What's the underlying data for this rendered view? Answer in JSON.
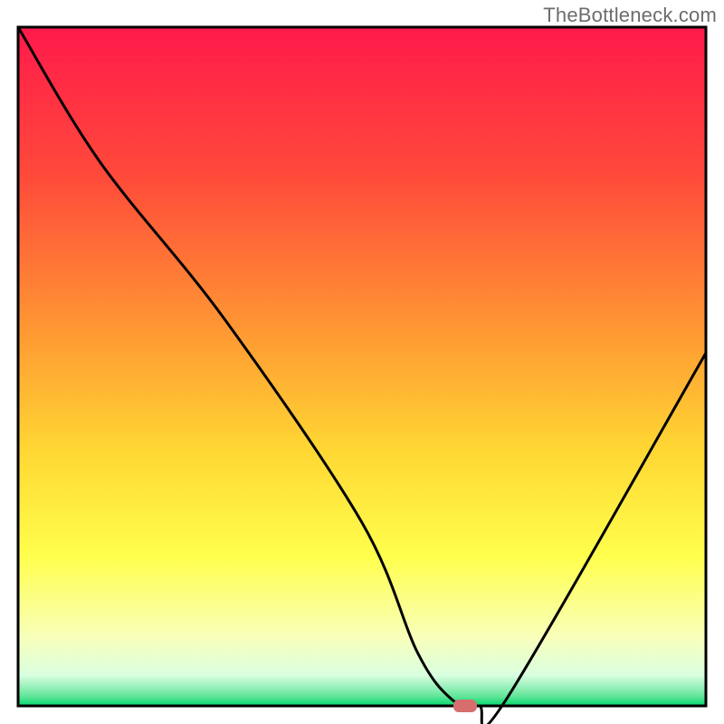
{
  "watermark": "TheBottleneck.com",
  "chart_data": {
    "type": "line",
    "title": "",
    "xlabel": "",
    "ylabel": "",
    "xlim": [
      0,
      100
    ],
    "ylim": [
      0,
      100
    ],
    "grid": false,
    "legend": false,
    "series": [
      {
        "name": "bottleneck-curve",
        "x": [
          0,
          12,
          30,
          50,
          58,
          63,
          67,
          71,
          100
        ],
        "y": [
          100,
          80,
          57,
          27,
          8,
          1,
          0,
          1,
          52
        ]
      }
    ],
    "marker": {
      "name": "sweet-spot",
      "x": 65,
      "y": 0,
      "color": "#d66e6e"
    },
    "gradient_stops": [
      {
        "offset": 0.0,
        "color": "#ff1a4b"
      },
      {
        "offset": 0.22,
        "color": "#ff4a3a"
      },
      {
        "offset": 0.45,
        "color": "#ff9933"
      },
      {
        "offset": 0.62,
        "color": "#ffd633"
      },
      {
        "offset": 0.78,
        "color": "#ffff4d"
      },
      {
        "offset": 0.9,
        "color": "#f8ffbb"
      },
      {
        "offset": 0.955,
        "color": "#d9ffe0"
      },
      {
        "offset": 0.985,
        "color": "#66e69c"
      },
      {
        "offset": 1.0,
        "color": "#00d86b"
      }
    ],
    "frame_color": "#000000",
    "curve_color": "#000000"
  }
}
